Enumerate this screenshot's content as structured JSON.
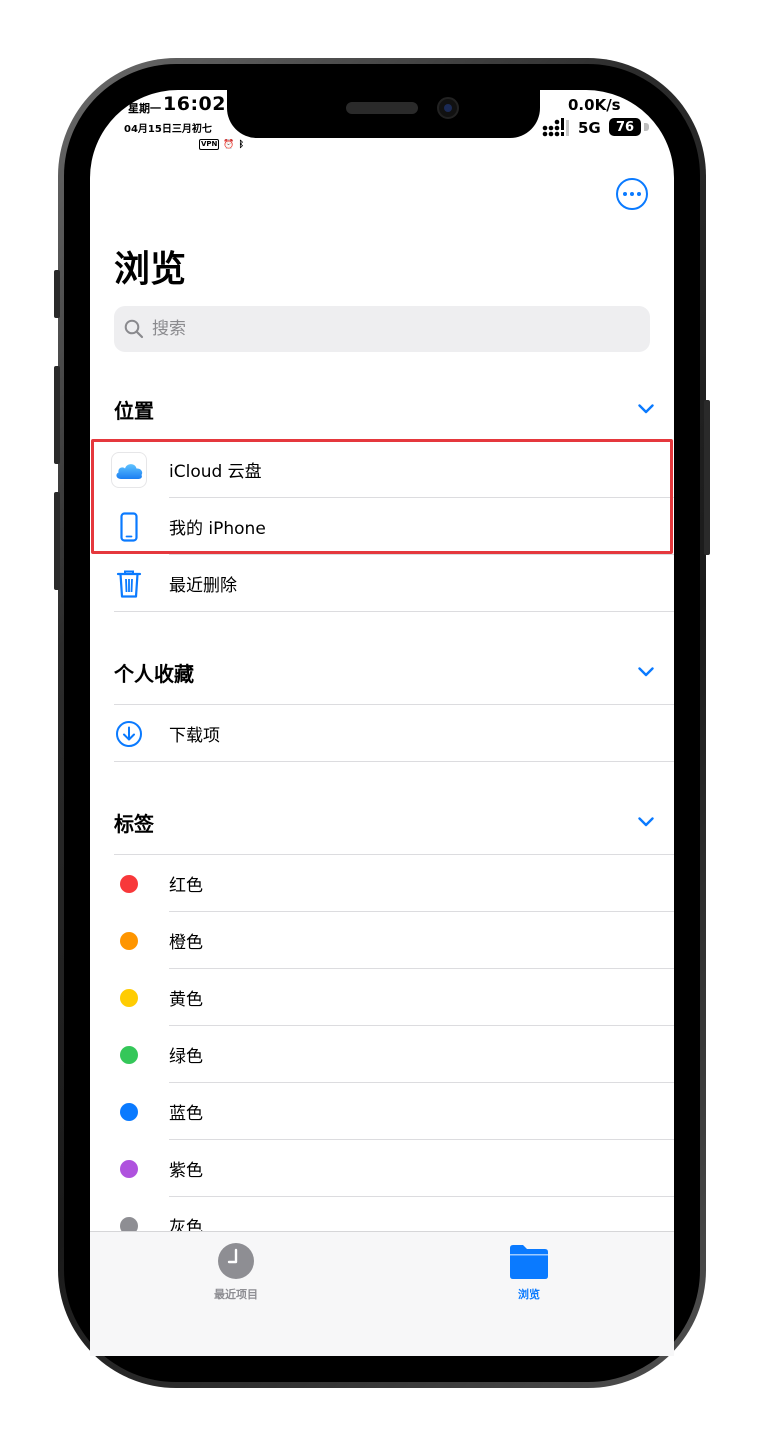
{
  "status_bar": {
    "weekday": "星期一",
    "time": "16:02",
    "date": "04月15日三月初七",
    "vpn": "VPN",
    "speed": "0.0K/s",
    "network": "5G",
    "battery": "76"
  },
  "page": {
    "title": "浏览"
  },
  "search": {
    "placeholder": "搜索"
  },
  "sections": {
    "locations": {
      "title": "位置",
      "items": [
        {
          "label": "iCloud 云盘",
          "icon": "icloud-icon"
        },
        {
          "label": "我的 iPhone",
          "icon": "iphone-icon"
        },
        {
          "label": "最近删除",
          "icon": "trash-icon"
        }
      ]
    },
    "favorites": {
      "title": "个人收藏",
      "items": [
        {
          "label": "下载项",
          "icon": "download-icon"
        }
      ]
    },
    "tags": {
      "title": "标签",
      "items": [
        {
          "label": "红色",
          "color": "#f8383a"
        },
        {
          "label": "橙色",
          "color": "#fe9500"
        },
        {
          "label": "黄色",
          "color": "#ffcc02"
        },
        {
          "label": "绿色",
          "color": "#34c759"
        },
        {
          "label": "蓝色",
          "color": "#0a7aff"
        },
        {
          "label": "紫色",
          "color": "#af52de"
        },
        {
          "label": "灰色",
          "color": "#8e8e93"
        }
      ]
    }
  },
  "tabbar": {
    "recents": {
      "label": "最近项目",
      "icon": "clock-icon"
    },
    "browse": {
      "label": "浏览",
      "icon": "folder-icon"
    }
  },
  "colors": {
    "accent": "#0a7aff",
    "highlight": "#e5383d"
  }
}
